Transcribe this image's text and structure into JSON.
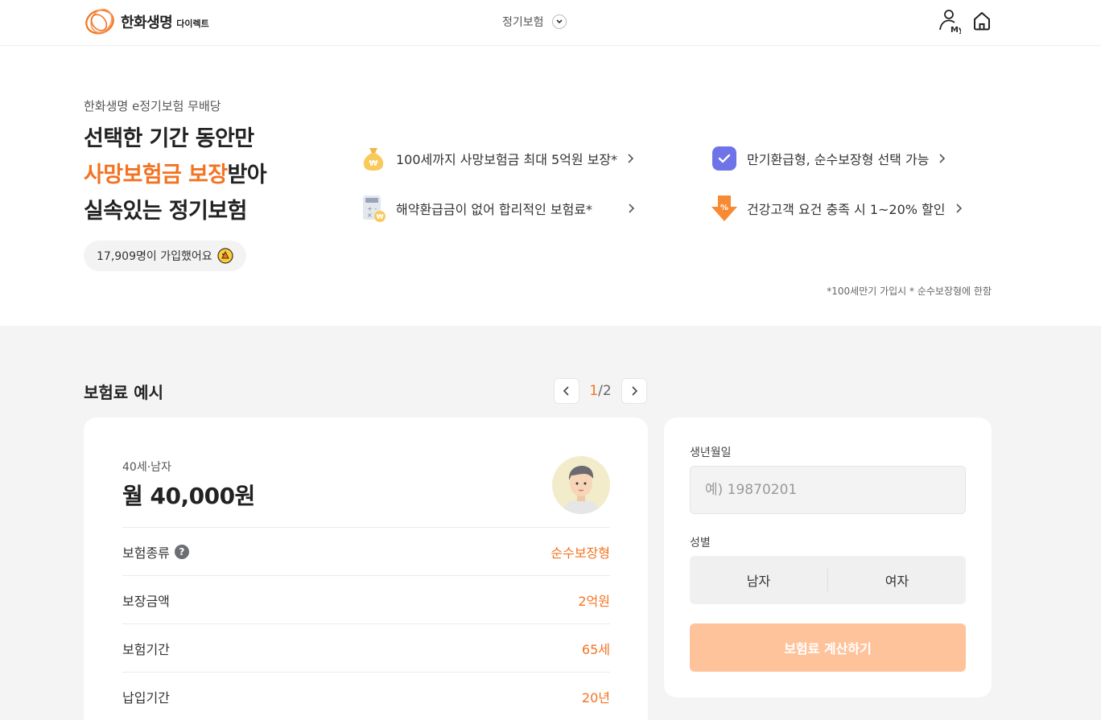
{
  "header": {
    "logo_main": "한화생명",
    "logo_sub": "다이렉트",
    "nav_select_label": "정기보험",
    "my_label": "My"
  },
  "hero": {
    "subtitle": "한화생명 e정기보험 무배당",
    "title_line1": "선택한 기간 동안만",
    "title_line2_accent": "사망보험금 보장",
    "title_line2_rest": "받아",
    "title_line3": "실속있는 정기보험",
    "join_text": "17,909명이 가입했어요"
  },
  "benefits": [
    {
      "text": "100세까지 사망보험금 최대 5억원 보장*",
      "icon": "money-bag-icon"
    },
    {
      "text": "만기환급형, 순수보장형 선택 가능",
      "icon": "check-badge-icon"
    },
    {
      "text": "해약환급금이 없어 합리적인 보험료*",
      "icon": "calculator-icon"
    },
    {
      "text": "건강고객 요건 충족 시 1~20% 할인",
      "icon": "discount-arrow-icon"
    }
  ],
  "footnote": "*100세만기 가입시 * 순수보장형에 한함",
  "example": {
    "section_title": "보험료 예시",
    "pager_current": "1",
    "pager_total": "/2",
    "card_sub": "40세·남자",
    "card_price": "월 40,000원",
    "rows": [
      {
        "label": "보험종류",
        "value": "순수보장형"
      },
      {
        "label": "보장금액",
        "value": "2억원"
      },
      {
        "label": "보험기간",
        "value": "65세"
      },
      {
        "label": "납입기간",
        "value": "20년"
      }
    ],
    "help_glyph": "?"
  },
  "form": {
    "birth_label": "생년월일",
    "birth_placeholder": "예) 19870201",
    "gender_label": "성별",
    "gender_male": "남자",
    "gender_female": "여자",
    "calc_button": "보험료 계산하기"
  },
  "colors": {
    "accent": "#f37321",
    "calc_button_disabled": "#ffc39b",
    "check_badge": "#6f73e8"
  }
}
